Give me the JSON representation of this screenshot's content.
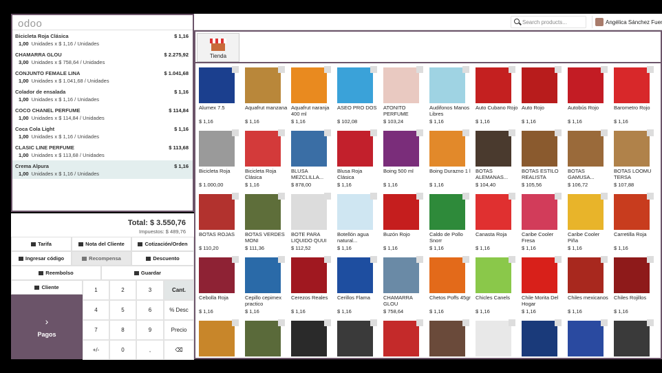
{
  "header": {
    "search_placeholder": "Search products...",
    "user_name": "Angélica Sánchez Fuentes"
  },
  "logo": "odoo",
  "order_lines": [
    {
      "name": "Bicicleta Roja Clásica",
      "price": "$ 1,16",
      "qty": "1,00",
      "detail": "Unidades x $ 1,16 / Unidades"
    },
    {
      "name": "CHAMARRA GLOU",
      "price": "$ 2.275,92",
      "qty": "3,00",
      "detail": "Unidades x $ 758,64 / Unidades"
    },
    {
      "name": "CONJUNTO FEMALE LINA",
      "price": "$ 1.041,68",
      "qty": "1,00",
      "detail": "Unidades x $ 1.041,68 / Unidades"
    },
    {
      "name": "Colador de ensalada",
      "price": "$ 1,16",
      "qty": "1,00",
      "detail": "Unidades x $ 1,16 / Unidades"
    },
    {
      "name": "COCO CHANEL PERFUME",
      "price": "$ 114,84",
      "qty": "1,00",
      "detail": "Unidades x $ 114,84 / Unidades"
    },
    {
      "name": "Coca Cola Light",
      "price": "$ 1,16",
      "qty": "1,00",
      "detail": "Unidades x $ 1,16 / Unidades"
    },
    {
      "name": "CLASIC LINE PERFUME",
      "price": "$ 113,68",
      "qty": "1,00",
      "detail": "Unidades x $ 113,68 / Unidades"
    },
    {
      "name": "Crema Alpura",
      "price": "$ 1,16",
      "qty": "1,00",
      "detail": "Unidades x $ 1,16 / Unidades"
    }
  ],
  "summary": {
    "total": "Total: $ 3.550,76",
    "taxes": "Impuestos: $ 489,76"
  },
  "controls": {
    "tarifa": "Tarifa",
    "nota": "Nota del Cliente",
    "cotizacion": "Cotización/Orden",
    "codigo": "Ingresar código",
    "recompensa": "Recompensa",
    "descuento": "Descuento",
    "reembolso": "Reembolso",
    "guardar": "Guardar",
    "cliente": "Cliente",
    "pagos": "Pagos"
  },
  "numpad": [
    "1",
    "2",
    "3",
    "Cant.",
    "4",
    "5",
    "6",
    "% Desc",
    "7",
    "8",
    "9",
    "Precio",
    "+/-",
    "0",
    ",",
    "⌫"
  ],
  "category": {
    "label": "Tienda"
  },
  "products": [
    {
      "name": "Alumex 7.5",
      "price": "$ 1,16",
      "color": "#1b3f8e"
    },
    {
      "name": "Aquafrut manzana",
      "price": "$ 1,16",
      "color": "#b9873a"
    },
    {
      "name": "Aquafrut naranja 400 ml",
      "price": "$ 1,16",
      "color": "#e98a1f"
    },
    {
      "name": "ASEO PRO DOS",
      "price": "$ 102,08",
      "color": "#3aa2d9"
    },
    {
      "name": "ATONITO PERFUME",
      "price": "$ 103,24",
      "color": "#e9c9c1"
    },
    {
      "name": "Audifonos Manos Libres",
      "price": "$ 1,16",
      "color": "#9fd3e3"
    },
    {
      "name": "Auto Cubano Rojo",
      "price": "$ 1,16",
      "color": "#c42020"
    },
    {
      "name": "Auto Rojo",
      "price": "$ 1,16",
      "color": "#b81c1c"
    },
    {
      "name": "Autobús Rojo",
      "price": "$ 1,16",
      "color": "#c31c24"
    },
    {
      "name": "Barometro Rojo",
      "price": "$ 1,16",
      "color": "#d8282a"
    },
    {
      "name": "Bicicleta Roja",
      "price": "$ 1.000,00",
      "color": "#9a9a9a"
    },
    {
      "name": "Bicicleta Roja Clásica",
      "price": "$ 1,16",
      "color": "#d33a3a"
    },
    {
      "name": "BLUSA MEZCLILLA...",
      "price": "$ 878,00",
      "color": "#3a6ea5"
    },
    {
      "name": "Blusa Roja Clásica",
      "price": "$ 1,16",
      "color": "#c2202c"
    },
    {
      "name": "Boing 500 ml",
      "price": "$ 1,16",
      "color": "#7a2d7a"
    },
    {
      "name": "Boing Durazno 1 l",
      "price": "$ 1,16",
      "color": "#e2892a"
    },
    {
      "name": "BOTAS ALEMANAS...",
      "price": "$ 104,40",
      "color": "#4a3a2e"
    },
    {
      "name": "BOTAS ESTILO REALISTA",
      "price": "$ 105,56",
      "color": "#8a5a2e"
    },
    {
      "name": "BOTAS GAMUSA...",
      "price": "$ 106,72",
      "color": "#9a6a3a"
    },
    {
      "name": "BOTAS LOOMU TERSA",
      "price": "$ 107,88",
      "color": "#b0824a"
    },
    {
      "name": "BOTAS ROJAS",
      "price": "$ 110,20",
      "color": "#b2322e"
    },
    {
      "name": "BOTAS VERDES MONI",
      "price": "$ 111,36",
      "color": "#5e6e3a"
    },
    {
      "name": "BOTE PARA LIQUIDO QUUI",
      "price": "$ 112,52",
      "color": "#dcdcdc"
    },
    {
      "name": "Botellón agua natural...",
      "price": "$ 1,16",
      "color": "#cfe6f2"
    },
    {
      "name": "Buzón Rojo",
      "price": "$ 1,16",
      "color": "#c51e1e"
    },
    {
      "name": "Caldo de Pollo Snorr",
      "price": "$ 1,16",
      "color": "#2e8a3a"
    },
    {
      "name": "Canasta Roja",
      "price": "$ 1,16",
      "color": "#e03030"
    },
    {
      "name": "Caribe Cooler Fresa",
      "price": "$ 1,16",
      "color": "#d23c5a"
    },
    {
      "name": "Caribe Cooler Piña",
      "price": "$ 1,16",
      "color": "#e8b42a"
    },
    {
      "name": "Carretilla Roja",
      "price": "$ 1,16",
      "color": "#c83c1e"
    },
    {
      "name": "Cebolla Roja",
      "price": "$ 1,16",
      "color": "#8e2234"
    },
    {
      "name": "Cepillo cepimex practico",
      "price": "$ 1,16",
      "color": "#2a6aa8"
    },
    {
      "name": "Cerezos Reales",
      "price": "$ 1,16",
      "color": "#a01820"
    },
    {
      "name": "Cerillos Flama",
      "price": "$ 1,16",
      "color": "#1e4ea0"
    },
    {
      "name": "CHAMARRA GLOU",
      "price": "$ 758,64",
      "color": "#6a8aa6"
    },
    {
      "name": "Chetos Poffs 45gr",
      "price": "$ 1,16",
      "color": "#e36a1a"
    },
    {
      "name": "Chicles Canels",
      "price": "$ 1,16",
      "color": "#8ac84a"
    },
    {
      "name": "Chile Morita Del Hogar",
      "price": "$ 1,16",
      "color": "#d8201a"
    },
    {
      "name": "Chiles mexicanos",
      "price": "$ 1,16",
      "color": "#a8281e"
    },
    {
      "name": "Chiles Rojillos",
      "price": "$ 1,16",
      "color": "#8e1a1a"
    },
    {
      "name": "",
      "price": "",
      "color": "#c8862a"
    },
    {
      "name": "",
      "price": "",
      "color": "#5a6a3a"
    },
    {
      "name": "",
      "price": "",
      "color": "#2a2a2a"
    },
    {
      "name": "",
      "price": "",
      "color": "#3a3a3a"
    },
    {
      "name": "",
      "price": "",
      "color": "#c42a2a"
    },
    {
      "name": "",
      "price": "",
      "color": "#6a4a3a"
    },
    {
      "name": "",
      "price": "",
      "color": "#e8e8e8"
    },
    {
      "name": "",
      "price": "",
      "color": "#1a3a7a"
    },
    {
      "name": "",
      "price": "",
      "color": "#2a4aa0"
    },
    {
      "name": "",
      "price": "",
      "color": "#3a3a3a"
    }
  ]
}
